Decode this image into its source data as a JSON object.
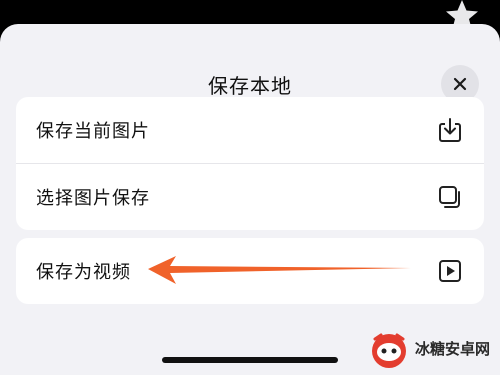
{
  "sheet": {
    "title": "保存本地",
    "close_icon": "close-icon"
  },
  "options_group": [
    {
      "label": "保存当前图片",
      "icon": "download-icon"
    },
    {
      "label": "选择图片保存",
      "icon": "select-copy-icon"
    }
  ],
  "video_option": {
    "label": "保存为视频",
    "icon": "play-icon"
  },
  "annotation": {
    "icon": "orange-arrow-pointer",
    "color": "#f0622a"
  },
  "watermark": {
    "text": "冰糖安卓网",
    "logo": "candy-logo"
  },
  "colors": {
    "sheet_bg": "#f2f2f6",
    "card_bg": "#ffffff",
    "accent": "#f0622a"
  }
}
